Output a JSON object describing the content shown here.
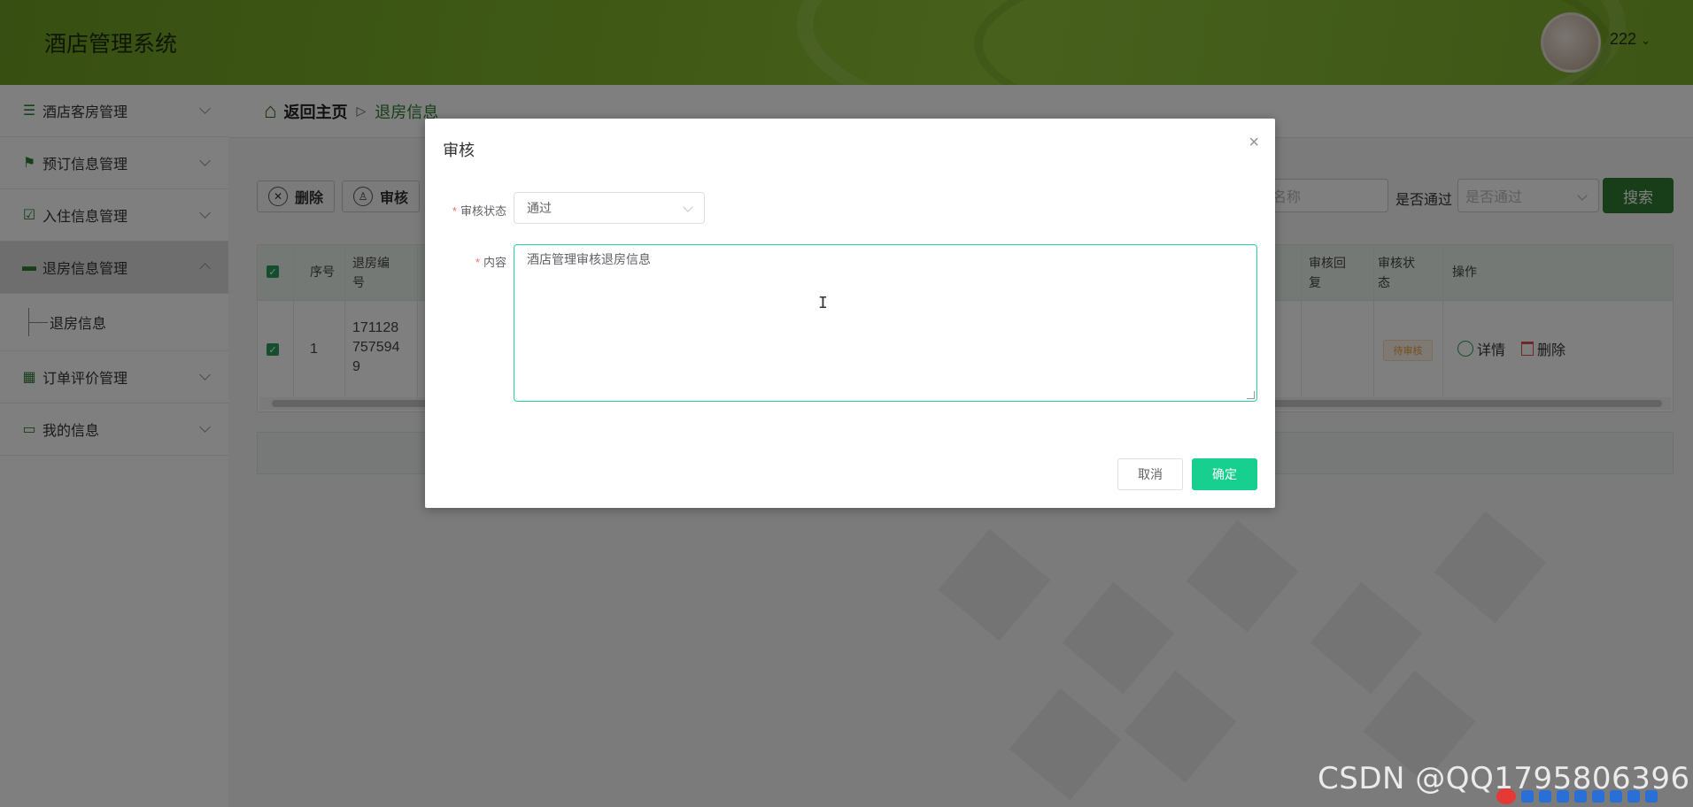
{
  "header": {
    "title": "酒店管理系统",
    "username": "222"
  },
  "sidebar": {
    "items": [
      {
        "label": "酒店客房管理",
        "icon": "list-icon"
      },
      {
        "label": "预订信息管理",
        "icon": "flag-icon"
      },
      {
        "label": "入住信息管理",
        "icon": "clipboard-check-icon"
      },
      {
        "label": "退房信息管理",
        "icon": "couch-icon",
        "active": true,
        "sub": [
          "退房信息"
        ]
      },
      {
        "label": "订单评价管理",
        "icon": "grid-icon"
      },
      {
        "label": "我的信息",
        "icon": "wallet-icon"
      }
    ]
  },
  "breadcrumb": {
    "home": "返回主页",
    "current": "退房信息"
  },
  "toolbar": {
    "delete": "删除",
    "audit": "审核"
  },
  "search": {
    "name_placeholder": "名称",
    "pass_label": "是否通过",
    "pass_placeholder": "是否通过",
    "button": "搜索"
  },
  "table": {
    "headers": {
      "index": "序号",
      "checkout_no": "退房编号",
      "audit_reply": "审核回复",
      "audit_status": "审核状态",
      "actions": "操作"
    },
    "rows": [
      {
        "index": "1",
        "checkout_no": "1711287575949",
        "audit_status": "待审核",
        "detail": "详情",
        "delete": "删除"
      }
    ]
  },
  "modal": {
    "title": "审核",
    "status_label": "审核状态",
    "status_value": "通过",
    "content_label": "内容",
    "content_value": "酒店管理审核退房信息",
    "cancel": "取消",
    "confirm": "确定"
  },
  "watermark": "CSDN @QQ1795806396",
  "colors": {
    "header": "#7fb32b",
    "primary": "#2f7d32",
    "confirm": "#17cf8f",
    "focus_border": "#2ecc9b"
  }
}
